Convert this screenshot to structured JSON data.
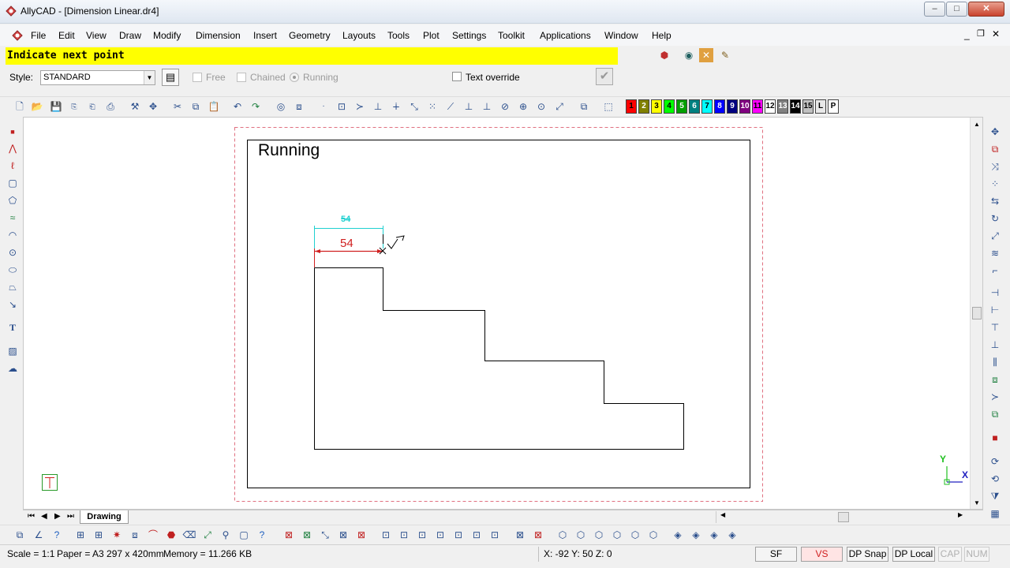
{
  "window": {
    "title": "AllyCAD - [Dimension Linear.dr4]",
    "minimize": "–",
    "maximize": "□",
    "close": "✕"
  },
  "menu": {
    "items": [
      "File",
      "Edit",
      "View",
      "Draw",
      "Modify",
      "Dimension",
      "Insert",
      "Geometry",
      "Layouts",
      "Tools",
      "Plot",
      "Settings",
      "Toolkit",
      "Applications",
      "Window",
      "Help"
    ]
  },
  "prompt": {
    "text": "Indicate next point"
  },
  "options": {
    "style_label": "Style:",
    "style_value": "STANDARD",
    "free_label": "Free",
    "chained_label": "Chained",
    "running_label": "Running",
    "text_override_label": "Text override"
  },
  "colors": {
    "items": [
      {
        "label": "1",
        "color": "#ff0000"
      },
      {
        "label": "2",
        "color": "#808000"
      },
      {
        "label": "3",
        "color": "#ffff00"
      },
      {
        "label": "4",
        "color": "#00ff00"
      },
      {
        "label": "5",
        "color": "#00a000"
      },
      {
        "label": "6",
        "color": "#008080"
      },
      {
        "label": "7",
        "color": "#00ffff"
      },
      {
        "label": "8",
        "color": "#0000ff"
      },
      {
        "label": "9",
        "color": "#000080"
      },
      {
        "label": "10",
        "color": "#800080"
      },
      {
        "label": "11",
        "color": "#ff00ff"
      },
      {
        "label": "12",
        "color": "#ffffff"
      },
      {
        "label": "13",
        "color": "#808080"
      },
      {
        "label": "14",
        "color": "#000000"
      },
      {
        "label": "15",
        "color": "#c0c0c0"
      },
      {
        "label": "L",
        "color": "#e8e8e8"
      },
      {
        "label": "P",
        "color": "#ffffff"
      }
    ]
  },
  "drawing": {
    "sheet_title": "Running",
    "dim_value": "54",
    "dim_preview": "54",
    "axis_y": "Y",
    "axis_x": "X"
  },
  "tabs": {
    "active": "Drawing"
  },
  "status": {
    "scale": "Scale = 1:1",
    "paper": "Paper = A3 297 x 420mm",
    "memory": "Memory = 11.266 KB",
    "coords": "X: -92 Y: 50 Z: 0",
    "sf": "SF",
    "vs": "VS",
    "dp_snap": "DP Snap",
    "dp_local": "DP Local",
    "cap": "CAP",
    "num": "NUM"
  }
}
